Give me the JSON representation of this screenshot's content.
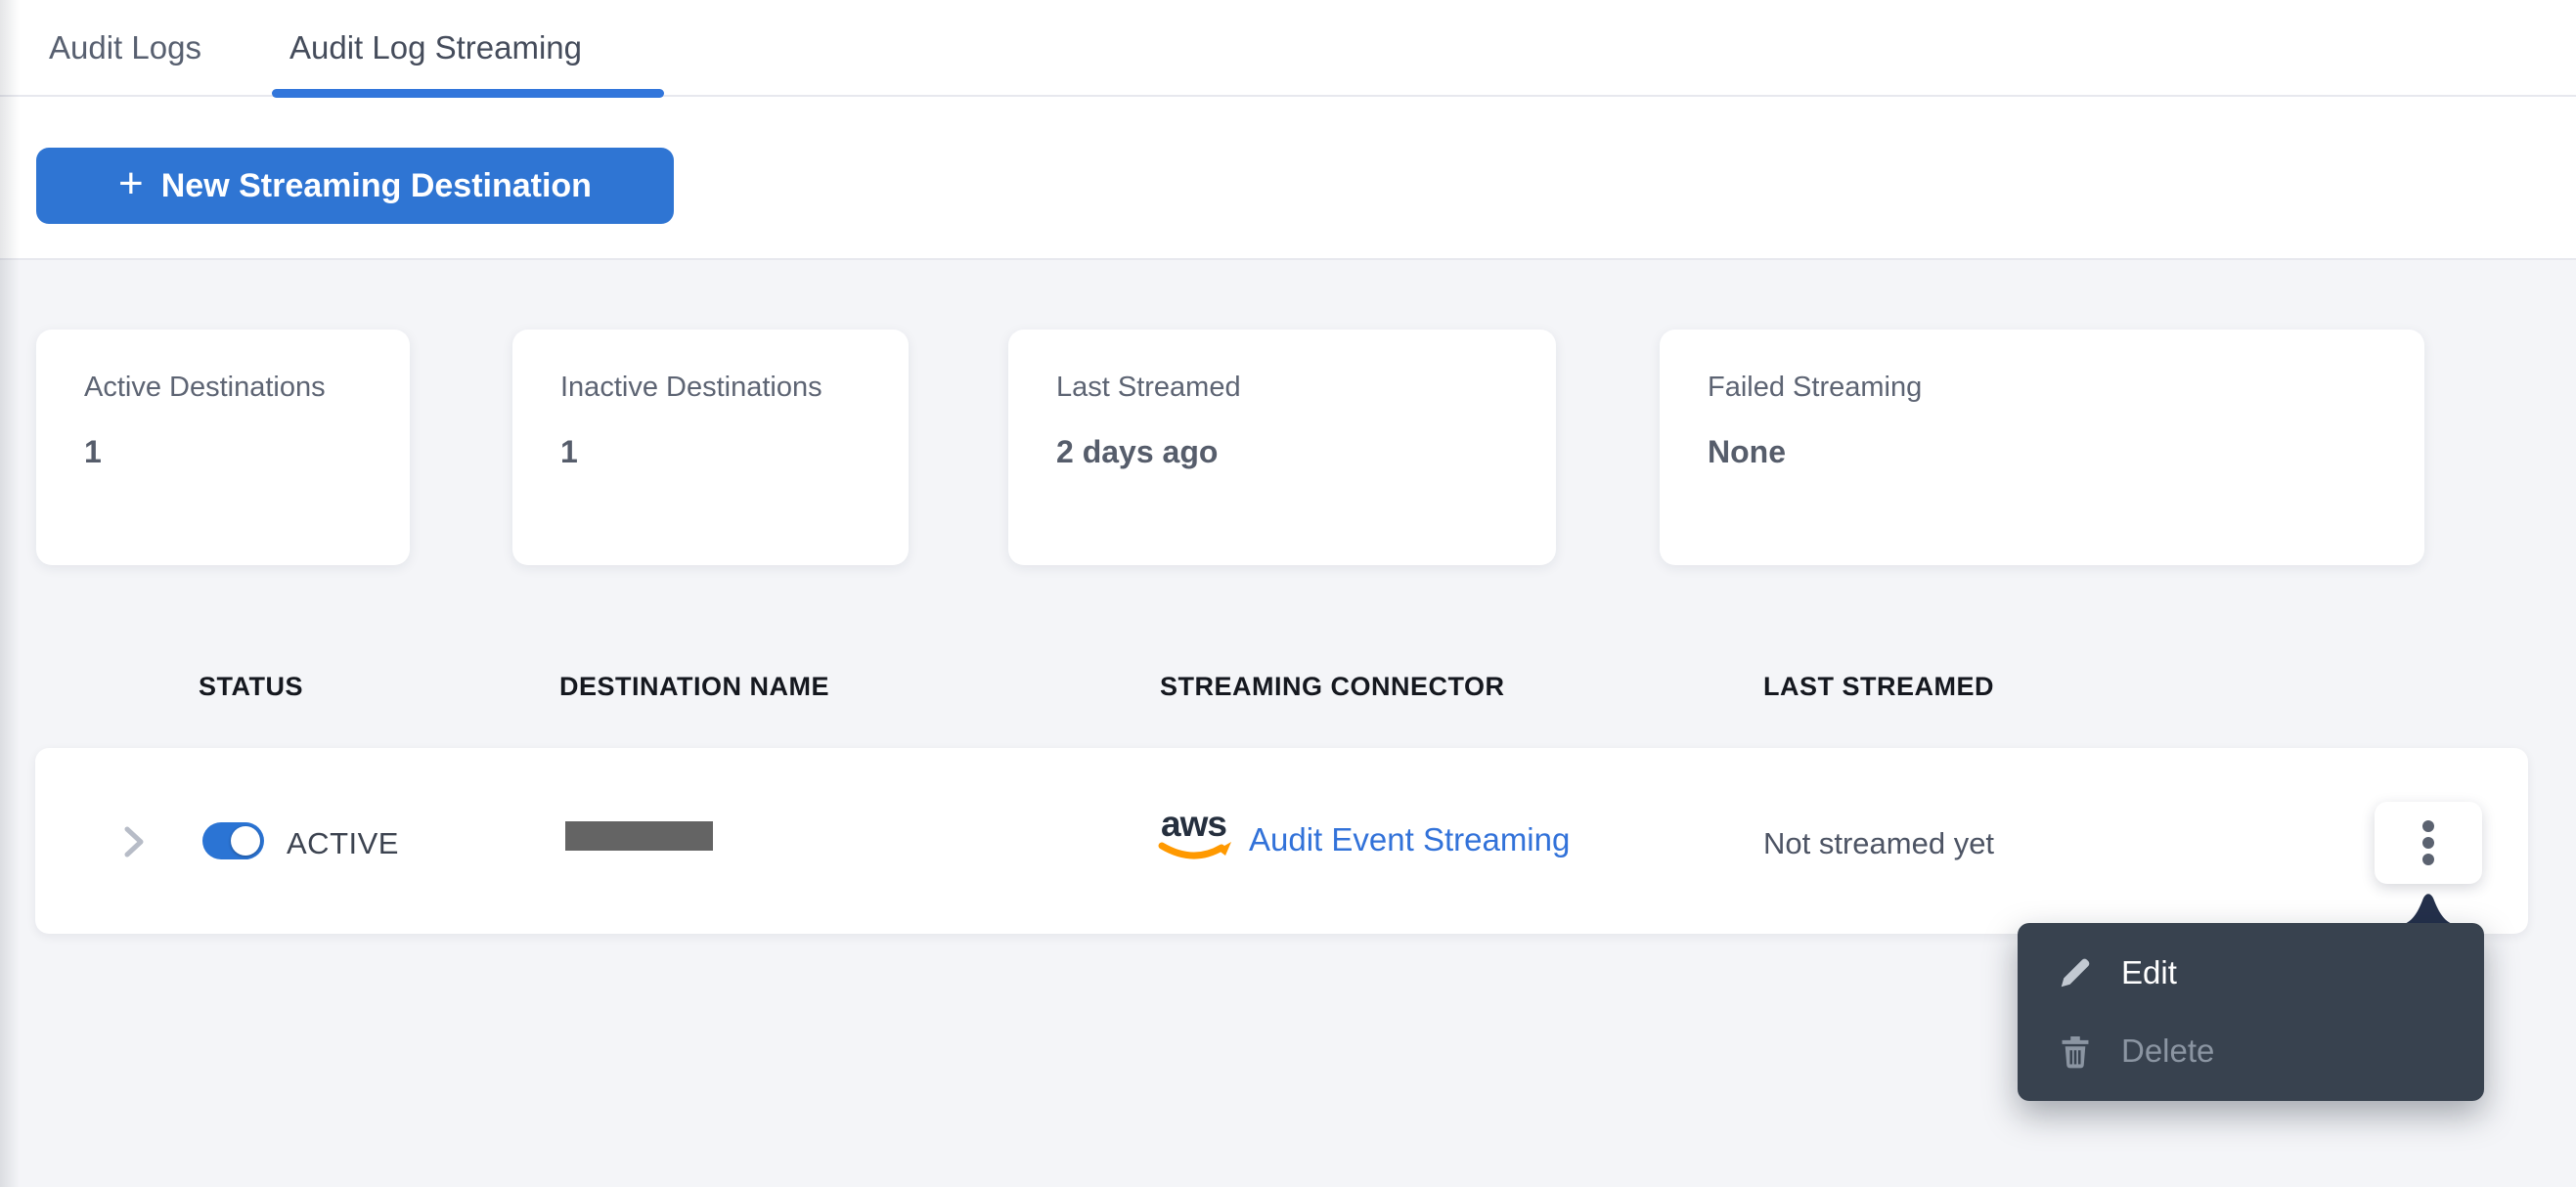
{
  "tabs": {
    "items": [
      {
        "label": "Audit Logs",
        "active": false
      },
      {
        "label": "Audit Log Streaming",
        "active": true
      }
    ]
  },
  "toolbar": {
    "plus": "+",
    "new_streaming_destination": "New Streaming Destination"
  },
  "stats": [
    {
      "label": "Active Destinations",
      "value": "1"
    },
    {
      "label": "Inactive Destinations",
      "value": "1"
    },
    {
      "label": "Last Streamed",
      "value": "2 days ago"
    },
    {
      "label": "Failed Streaming",
      "value": "None"
    }
  ],
  "table": {
    "columns": [
      "STATUS",
      "DESTINATION NAME",
      "STREAMING CONNECTOR",
      "LAST STREAMED"
    ],
    "row": {
      "status": "ACTIVE",
      "toggle_on": true,
      "destination_name_redacted": true,
      "connector_logo": "aws",
      "connector": "Audit Event Streaming",
      "last_streamed": "Not streamed yet"
    }
  },
  "menu": {
    "items": [
      {
        "label": "Edit",
        "icon": "pencil-icon",
        "enabled": true
      },
      {
        "label": "Delete",
        "icon": "trash-icon",
        "enabled": false
      }
    ]
  },
  "colors": {
    "accent_blue": "#2f75d3",
    "tab_underline_blue": "#3276db",
    "link_blue": "#3272d9",
    "toggle_blue": "#2b74d4",
    "menu_bg": "#38424f",
    "menu_caret": "#24304b",
    "aws_orange": "#ff9900",
    "aws_navy": "#252f3e",
    "page_bg_gray": "#f4f5f8",
    "redaction_gray": "#646464"
  }
}
